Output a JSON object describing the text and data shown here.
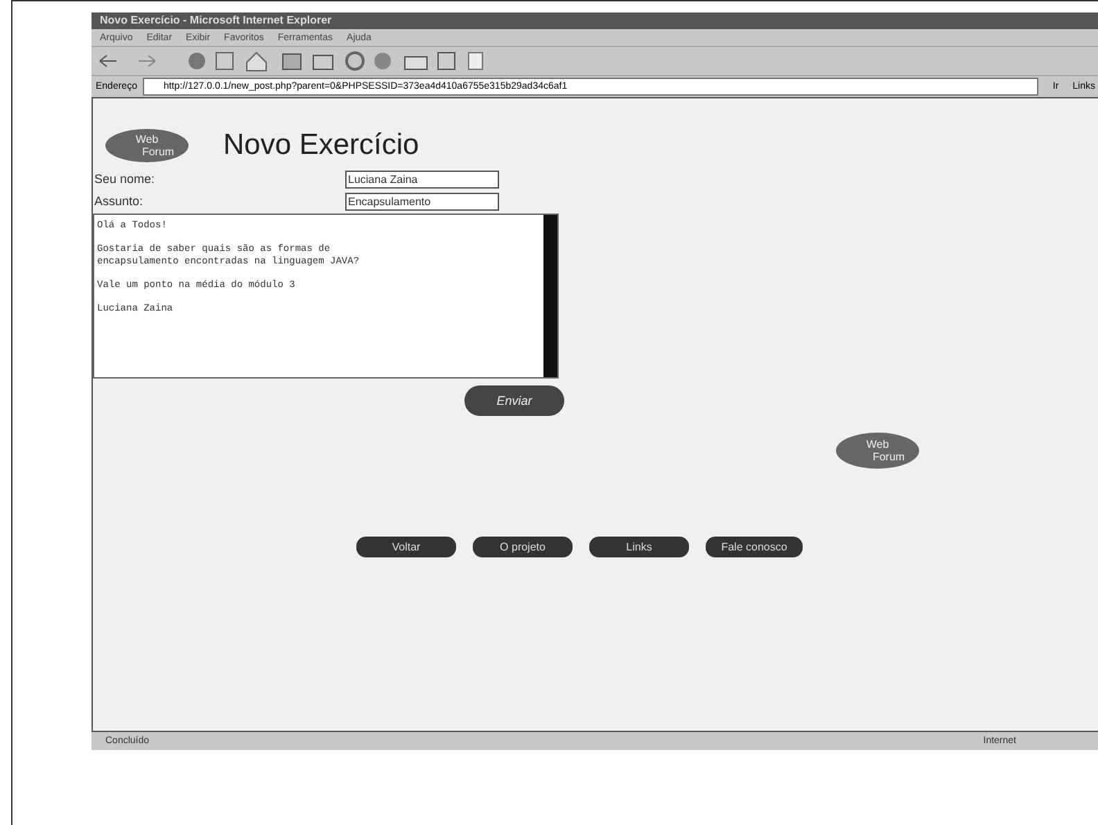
{
  "window": {
    "title": "Novo Exercício - Microsoft Internet Explorer"
  },
  "menu": [
    "Arquivo",
    "Editar",
    "Exibir",
    "Favoritos",
    "Ferramentas",
    "Ajuda"
  ],
  "address": {
    "label": "Endereço",
    "url": "http://127.0.0.1/new_post.php?parent=0&PHPSESSID=373ea4d410a6755e315b29ad34c6af1",
    "go": "Ir",
    "links": "Links"
  },
  "page": {
    "logo": [
      "Web",
      "Forum"
    ],
    "logo_bottom": [
      "Web",
      "Forum"
    ],
    "title": "Novo Exercício",
    "fields": [
      {
        "label": "Seu nome:",
        "value": "Luciana Zaina"
      },
      {
        "label": "Assunto:",
        "value": "Encapsulamento"
      }
    ],
    "message": [
      [
        "Olá a Todos!"
      ],
      [
        "Gostaria de saber quais são as formas de",
        "encapsulamento encontradas na linguagem JAVA?"
      ],
      [
        "Vale um ponto na média do módulo 3"
      ],
      [
        "Luciana Zaina"
      ]
    ],
    "send": "Enviar",
    "nav": [
      "Voltar",
      "O projeto",
      "Links",
      "Fale conosco"
    ]
  },
  "status_bar": {
    "text": "Concluído",
    "zone": "Internet"
  }
}
